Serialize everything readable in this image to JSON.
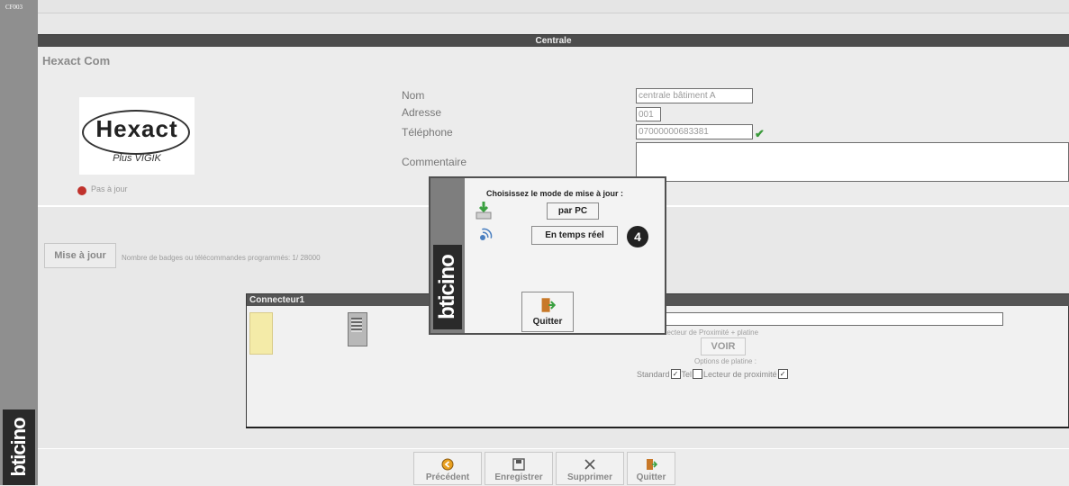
{
  "page_code": "CF003",
  "brand": "bticino",
  "title_bar": "Centrale",
  "section_title": "Hexact Com",
  "logo": {
    "word": "Hexact",
    "sub": "Plus VIGIK"
  },
  "status": {
    "text": "Pas à jour"
  },
  "form": {
    "nom_label": "Nom",
    "nom_value": "centrale bâtiment A",
    "adresse_label": "Adresse",
    "adresse_value": "001",
    "telephone_label": "Téléphone",
    "telephone_value": "07000000683381",
    "commentaire_label": "Commentaire",
    "commentaire_value": ""
  },
  "update": {
    "button": "Mise à jour",
    "badges_text": "Nombre de badges ou télécommandes programmés: 1/ 28000"
  },
  "connector": {
    "header": "Connecteur1",
    "prox_label": "Lecteur de Proximité + platine",
    "voir_button": "VOIR",
    "options_label": "Options de platine :",
    "opt_standard": "Standard",
    "opt_tel": "Tel",
    "opt_lecteur": "Lecteur de proximité",
    "checks": {
      "standard": true,
      "tel": false,
      "lecteur": true
    }
  },
  "modal": {
    "title": "Choisissez le mode de mise à jour :",
    "btn_pc": "par PC",
    "btn_realtime": "En temps réel",
    "badge": "4",
    "quit": "Quitter"
  },
  "footer": {
    "precedent": "Précédent",
    "enregistrer": "Enregistrer",
    "supprimer": "Supprimer",
    "quitter": "Quitter"
  },
  "colors": {
    "title_bar": "#4c4c4c",
    "check_green": "#3a9a3a",
    "status_red": "#c0322c",
    "note_yellow": "#f4eba8"
  }
}
